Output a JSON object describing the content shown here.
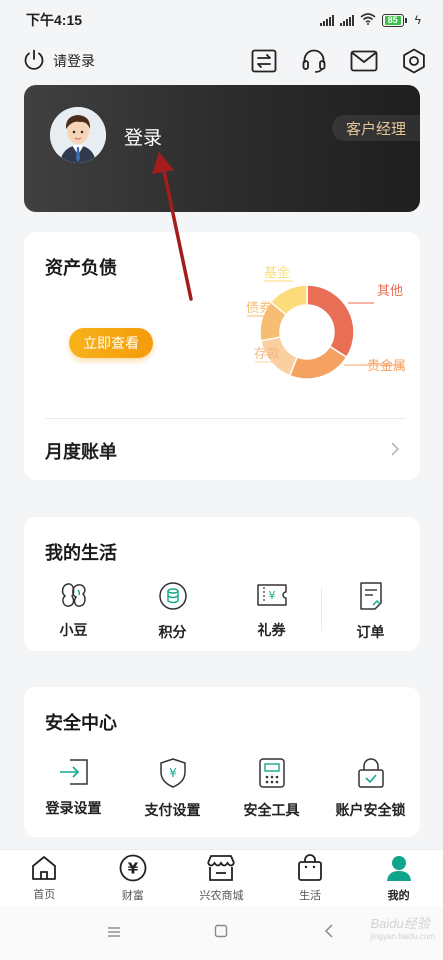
{
  "status_bar": {
    "time": "下午4:15",
    "battery": "85"
  },
  "top_bar": {
    "login_prompt": "请登录",
    "icons": [
      "switch-icon",
      "headset-icon",
      "mail-icon",
      "gear-icon"
    ]
  },
  "profile": {
    "login_label": "登录",
    "manager_label": "客户经理"
  },
  "assets": {
    "title": "资产负债",
    "view_button": "立即查看",
    "bill_label": "月度账单"
  },
  "chart_data": {
    "type": "pie",
    "slices": [
      {
        "label": "其他",
        "value": 34,
        "color": "#e86f55"
      },
      {
        "label": "贵金属",
        "value": 22,
        "color": "#f4a161"
      },
      {
        "label": "存款",
        "value": 16,
        "color": "#fbd0a0"
      },
      {
        "label": "债券",
        "value": 14,
        "color": "#f7bd73"
      },
      {
        "label": "基金",
        "value": 14,
        "color": "#fcdc7a"
      }
    ]
  },
  "life": {
    "title": "我的生活",
    "items": [
      {
        "label": "小豆",
        "icon": "bean-icon"
      },
      {
        "label": "积分",
        "icon": "points-icon"
      },
      {
        "label": "礼券",
        "icon": "coupon-icon"
      },
      {
        "label": "订单",
        "icon": "order-icon"
      }
    ]
  },
  "security": {
    "title": "安全中心",
    "items": [
      {
        "label": "登录设置",
        "icon": "login-settings-icon"
      },
      {
        "label": "支付设置",
        "icon": "payment-shield-icon"
      },
      {
        "label": "安全工具",
        "icon": "security-tool-icon"
      },
      {
        "label": "账户安全锁",
        "icon": "lock-icon"
      }
    ]
  },
  "tabs": [
    {
      "label": "首页",
      "icon": "home-icon"
    },
    {
      "label": "财富",
      "icon": "wealth-icon"
    },
    {
      "label": "兴农商城",
      "icon": "store-icon"
    },
    {
      "label": "生活",
      "icon": "shopping-bag-icon"
    },
    {
      "label": "我的",
      "icon": "person-icon",
      "active": true
    }
  ],
  "watermark": {
    "text": "Baidu经验",
    "sub": "jingyan.baidu.com"
  },
  "colors": {
    "accent": "#0fa58a",
    "button": "#f7b21a",
    "arrow": "#a31d1d"
  }
}
